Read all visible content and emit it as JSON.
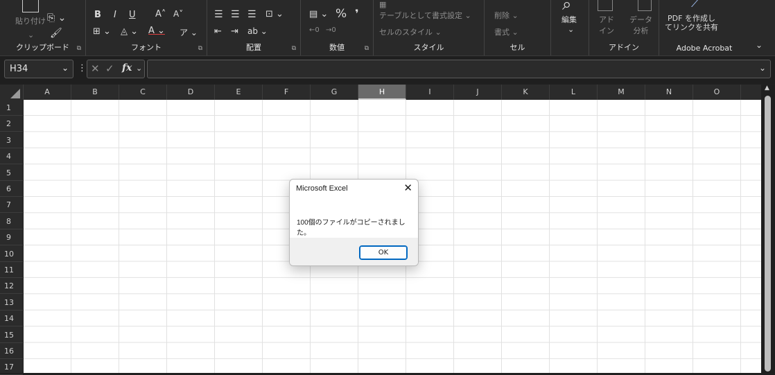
{
  "ribbon": {
    "clipboard": {
      "label": "クリップボード",
      "paste": "貼り付け"
    },
    "font": {
      "label": "フォント",
      "bold": "B",
      "italic": "I",
      "underline": "U",
      "grow": "A˄",
      "shrink": "A˅"
    },
    "alignment": {
      "label": "配置"
    },
    "number": {
      "label": "数値",
      "percent": "%",
      "comma": "❜"
    },
    "styles": {
      "label": "スタイル",
      "table_format": "テーブルとして書式設定 ⌄",
      "cell_styles": "セルのスタイル ⌄"
    },
    "cells": {
      "label": "セル",
      "delete": "削除 ⌄",
      "format": "書式 ⌄"
    },
    "editing": {
      "label": "編集"
    },
    "addins": {
      "label": "アドイン",
      "addin": "アド\nイン",
      "data_analysis": "データ\n分析"
    },
    "acrobat": {
      "label": "Adobe Acrobat",
      "create_pdf": "PDF を作成し\nてリンクを共有"
    }
  },
  "formula_bar": {
    "name_box": "H34",
    "fx": "fx",
    "formula": ""
  },
  "sheet": {
    "columns": [
      "A",
      "B",
      "C",
      "D",
      "E",
      "F",
      "G",
      "H",
      "I",
      "J",
      "K",
      "L",
      "M",
      "N",
      "O"
    ],
    "selected_column": "H",
    "rows": [
      "1",
      "2",
      "3",
      "4",
      "5",
      "6",
      "7",
      "8",
      "9",
      "10",
      "11",
      "12",
      "13",
      "14",
      "15",
      "16",
      "17"
    ]
  },
  "dialog": {
    "title": "Microsoft Excel",
    "message": "100個のファイルがコピーされました。",
    "ok_label": "OK"
  },
  "colors": {
    "accent": "#0067c0",
    "ribbon_bg": "#292929",
    "selected_header": "#6a6a6a"
  }
}
